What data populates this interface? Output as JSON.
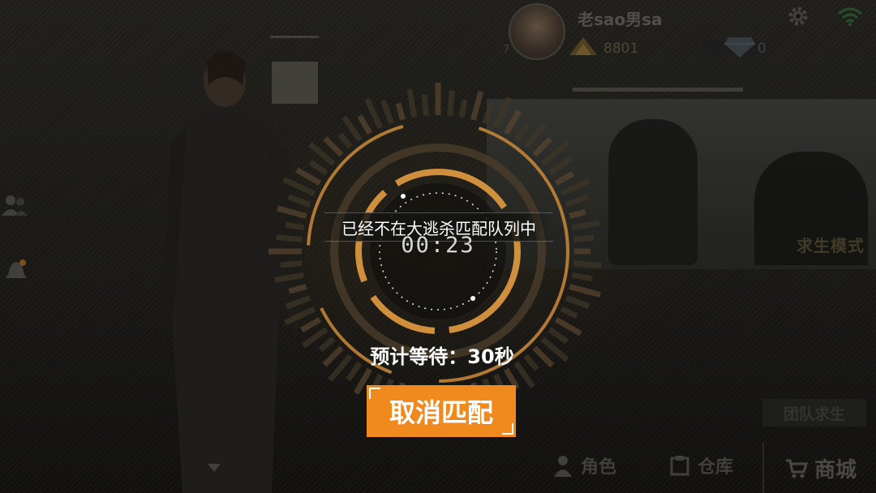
{
  "profile": {
    "username": "老sao男sa",
    "level": "7",
    "coins": "8801",
    "gems": "0"
  },
  "icons": {
    "settings": "gear-icon",
    "network": "wifi-icon",
    "friends": "friends-icon",
    "notifications": "bell-icon",
    "coin": "coin-icon",
    "gem": "diamond-icon"
  },
  "promo": {
    "mode_label": "求生模式",
    "team_mode_label": "团队求生"
  },
  "matchmaking": {
    "status_message": "已经不在大逃杀匹配队列中",
    "timer": "00:23",
    "estimated_wait": "预计等待：30秒",
    "cancel_label": "取消匹配"
  },
  "bottom_nav": {
    "role_label": "角色",
    "warehouse_label": "仓库",
    "shop_label": "商城"
  },
  "colors": {
    "accent_orange": "#f08a1e",
    "ring_orange": "#c98a3a",
    "background": "#1d1c19"
  }
}
